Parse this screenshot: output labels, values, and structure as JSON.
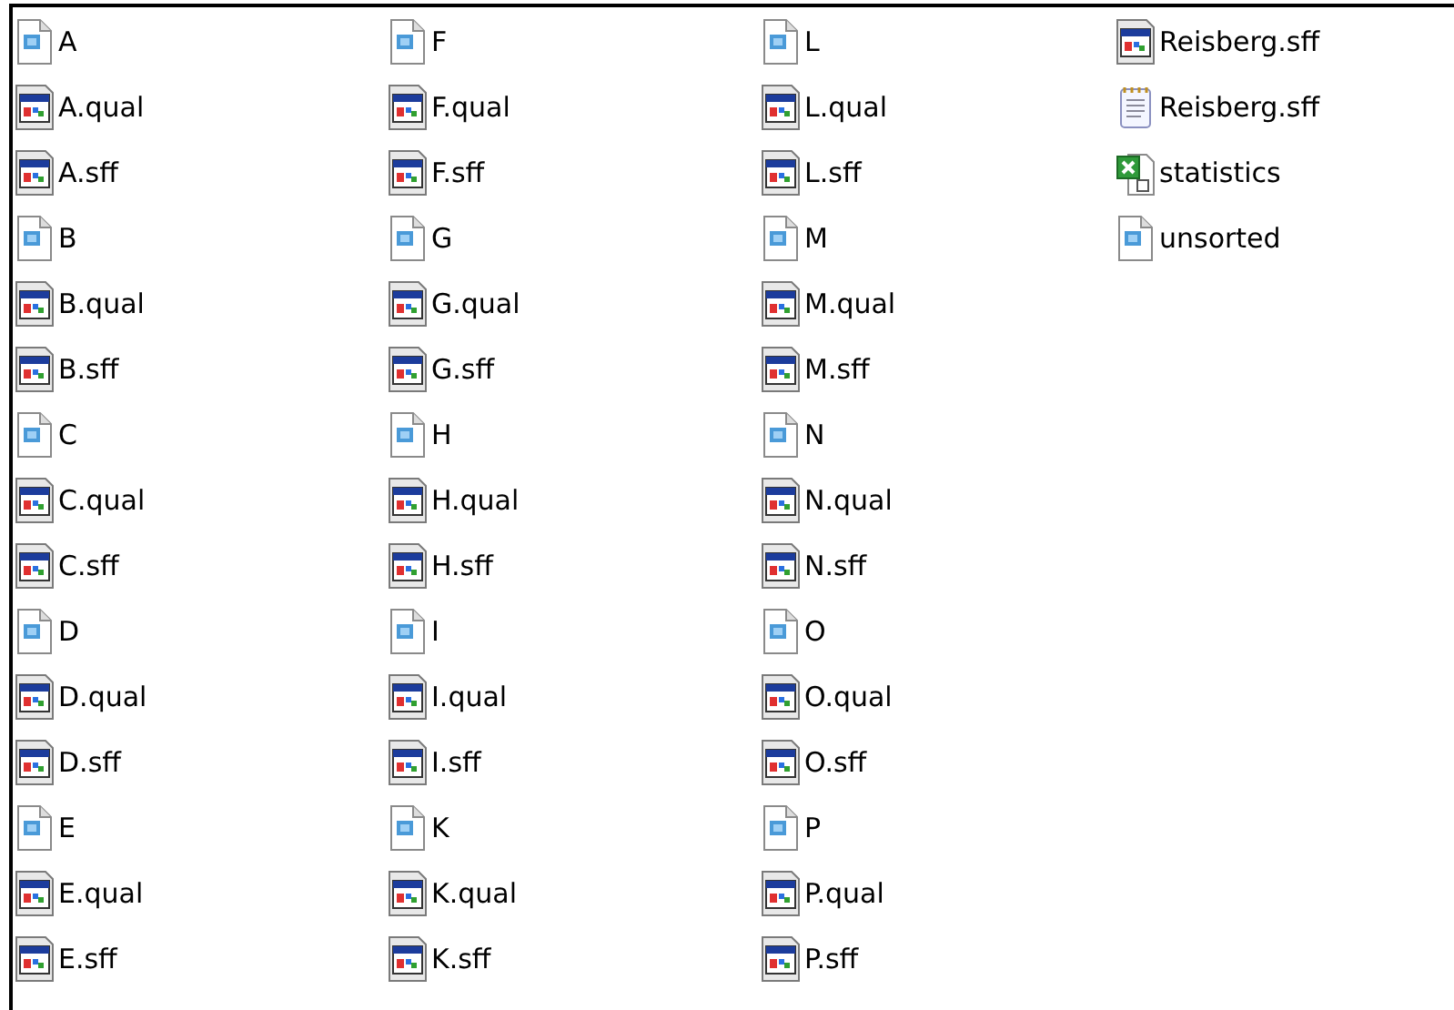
{
  "files": [
    {
      "name": "A",
      "kind": "file"
    },
    {
      "name": "A.qual",
      "kind": "app"
    },
    {
      "name": "A.sff",
      "kind": "app"
    },
    {
      "name": "B",
      "kind": "file"
    },
    {
      "name": "B.qual",
      "kind": "app"
    },
    {
      "name": "B.sff",
      "kind": "app"
    },
    {
      "name": "C",
      "kind": "file"
    },
    {
      "name": "C.qual",
      "kind": "app"
    },
    {
      "name": "C.sff",
      "kind": "app"
    },
    {
      "name": "D",
      "kind": "file"
    },
    {
      "name": "D.qual",
      "kind": "app"
    },
    {
      "name": "D.sff",
      "kind": "app"
    },
    {
      "name": "E",
      "kind": "file"
    },
    {
      "name": "E.qual",
      "kind": "app"
    },
    {
      "name": "E.sff",
      "kind": "app"
    },
    {
      "name": "F",
      "kind": "file"
    },
    {
      "name": "F.qual",
      "kind": "app"
    },
    {
      "name": "F.sff",
      "kind": "app"
    },
    {
      "name": "G",
      "kind": "file"
    },
    {
      "name": "G.qual",
      "kind": "app"
    },
    {
      "name": "G.sff",
      "kind": "app"
    },
    {
      "name": "H",
      "kind": "file"
    },
    {
      "name": "H.qual",
      "kind": "app"
    },
    {
      "name": "H.sff",
      "kind": "app"
    },
    {
      "name": "I",
      "kind": "file"
    },
    {
      "name": "I.qual",
      "kind": "app"
    },
    {
      "name": "I.sff",
      "kind": "app"
    },
    {
      "name": "K",
      "kind": "file"
    },
    {
      "name": "K.qual",
      "kind": "app"
    },
    {
      "name": "K.sff",
      "kind": "app"
    },
    {
      "name": "L",
      "kind": "file"
    },
    {
      "name": "L.qual",
      "kind": "app"
    },
    {
      "name": "L.sff",
      "kind": "app"
    },
    {
      "name": "M",
      "kind": "file"
    },
    {
      "name": "M.qual",
      "kind": "app"
    },
    {
      "name": "M.sff",
      "kind": "app"
    },
    {
      "name": "N",
      "kind": "file"
    },
    {
      "name": "N.qual",
      "kind": "app"
    },
    {
      "name": "N.sff",
      "kind": "app"
    },
    {
      "name": "O",
      "kind": "file"
    },
    {
      "name": "O.qual",
      "kind": "app"
    },
    {
      "name": "O.sff",
      "kind": "app"
    },
    {
      "name": "P",
      "kind": "file"
    },
    {
      "name": "P.qual",
      "kind": "app"
    },
    {
      "name": "P.sff",
      "kind": "app"
    },
    {
      "name": "Reisberg.sff",
      "kind": "app"
    },
    {
      "name": "Reisberg.sff",
      "kind": "text"
    },
    {
      "name": "statistics",
      "kind": "excel"
    },
    {
      "name": "unsorted",
      "kind": "file"
    }
  ]
}
